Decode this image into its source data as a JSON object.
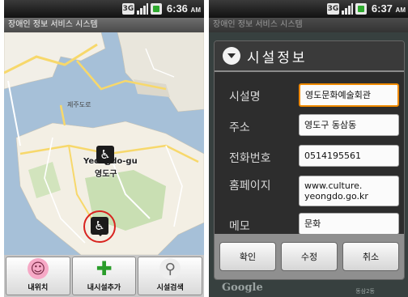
{
  "left_screen": {
    "status": {
      "network": "3G",
      "time": "6:36",
      "ampm": "AM"
    },
    "app_title": "장애인 정보 서비스 시스템",
    "map": {
      "labels": [
        "제주도로",
        "Yeongdo-gu",
        "영도구"
      ],
      "marker_icon": "wheelchair-icon"
    },
    "toolbar": [
      {
        "label": "내위치",
        "icon": "my-location-face-icon"
      },
      {
        "label": "내시설추가",
        "icon": "add-plus-icon"
      },
      {
        "label": "시설검색",
        "icon": "search-magnifier-icon"
      }
    ]
  },
  "right_screen": {
    "status": {
      "network": "3G",
      "time": "6:37",
      "ampm": "AM"
    },
    "app_title": "장애인 정보 서비스 시스템",
    "dialog": {
      "title": "시설정보",
      "fields": [
        {
          "label": "시설명",
          "value": "영도문화예술회관"
        },
        {
          "label": "주소",
          "value": "영도구 동삼동"
        },
        {
          "label": "전화번호",
          "value": "0514195561"
        },
        {
          "label": "홈페이지",
          "value": "www.culture.\nyeongdo.go.kr"
        },
        {
          "label": "메모",
          "value": "문화"
        }
      ],
      "buttons": {
        "confirm": "확인",
        "edit": "수정",
        "cancel": "취소"
      }
    },
    "map_watermark": "Google",
    "map_area_label": "동삼2동"
  },
  "colors": {
    "focus_border": "#f08a00",
    "marker_ring": "#d8231f",
    "add_green": "#2a9d2a"
  }
}
